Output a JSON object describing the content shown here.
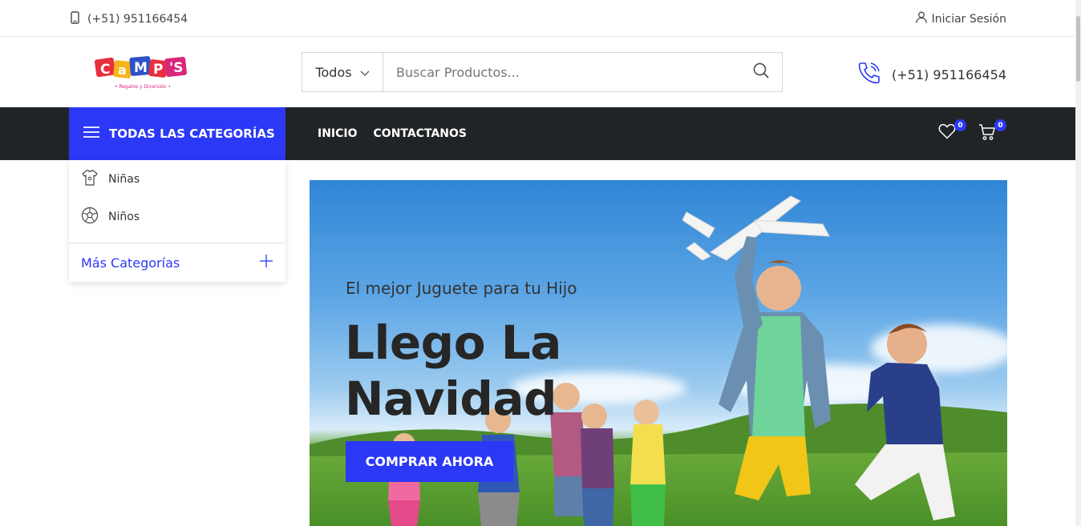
{
  "topbar": {
    "phone": "(+51) 951166454",
    "login_label": "Iniciar Sesión"
  },
  "header": {
    "logo_text": "CAMP'S",
    "logo_tagline": "• Regalos y Diversión •",
    "search": {
      "category_label": "Todos",
      "placeholder": "Buscar Productos..."
    },
    "phone": "(+51) 951166454"
  },
  "navbar": {
    "all_categories_label": "TODAS LAS CATEGORÍAS",
    "links": [
      "INICIO",
      "CONTACTANOS"
    ],
    "wishlist_count": "0",
    "cart_count": "0"
  },
  "categories": {
    "items": [
      {
        "label": "Niñas",
        "icon": "dress-icon"
      },
      {
        "label": "Niños",
        "icon": "soccer-ball-icon"
      }
    ],
    "more_label": "Más Categorías"
  },
  "hero": {
    "subtitle": "El mejor Juguete para tu Hijo",
    "title_line1": "Llego La",
    "title_line2": "Navidad",
    "button_label": "COMPRAR AHORA"
  },
  "colors": {
    "accent": "#2b38f6",
    "navbar_bg": "#212426"
  }
}
